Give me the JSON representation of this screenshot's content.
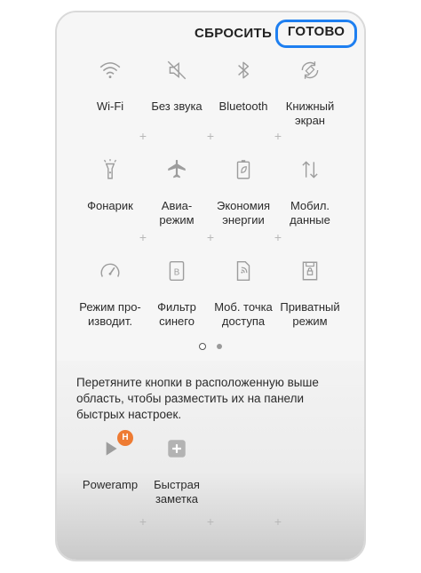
{
  "header": {
    "reset_label": "СБРОСИТЬ",
    "done_label": "ГОТОВО"
  },
  "active_tiles": [
    {
      "label": "Wi-Fi",
      "icon": "wifi-icon"
    },
    {
      "label": "Без звука",
      "icon": "mute-icon"
    },
    {
      "label": "Bluetooth",
      "icon": "bluetooth-icon"
    },
    {
      "label": "Книжный\nэкран",
      "icon": "screen-rotation-icon"
    },
    {
      "label": "Фонарик",
      "icon": "flashlight-icon"
    },
    {
      "label": "Авиа-\nрежим",
      "icon": "airplane-icon"
    },
    {
      "label": "Экономия\nэнергии",
      "icon": "battery-saver-icon"
    },
    {
      "label": "Мобил.\nданные",
      "icon": "mobile-data-icon"
    },
    {
      "label": "Режим про-\nизводит.",
      "icon": "performance-mode-icon"
    },
    {
      "label": "Фильтр\nсинего",
      "icon": "blue-light-filter-icon"
    },
    {
      "label": "Моб. точка\nдоступа",
      "icon": "hotspot-icon"
    },
    {
      "label": "Приватный\nрежим",
      "icon": "private-mode-icon"
    }
  ],
  "pagination": {
    "pages": 2,
    "current": 1
  },
  "available": {
    "instruction": "Перетяните кнопки в расположенную выше область, чтобы разместить их на панели быстрых настроек.",
    "tiles": [
      {
        "label": "Poweramp",
        "icon": "poweramp-icon",
        "badge": "H"
      },
      {
        "label": "Быстрая\nзаметка",
        "icon": "quick-note-icon"
      }
    ]
  },
  "colors": {
    "accent": "#1e7ff0",
    "badge": "#ee7b33",
    "icon": "#9d9d9d",
    "text": "#2b2b2b"
  }
}
